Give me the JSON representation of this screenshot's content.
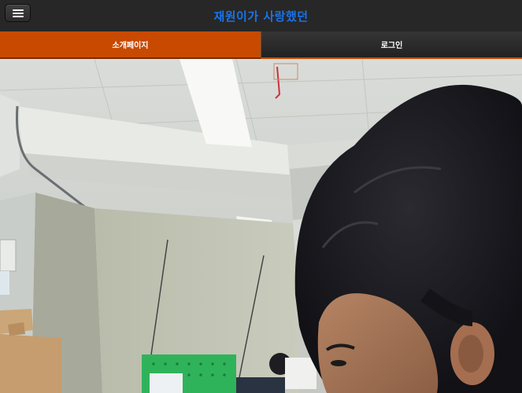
{
  "header": {
    "title": "재원이가 사랑했던",
    "menu_icon": "hamburger-menu-icon"
  },
  "nav": {
    "tabs": [
      {
        "label": "소개페이지",
        "active": true
      },
      {
        "label": "로그인",
        "active": false
      }
    ]
  },
  "colors": {
    "title": "#1a73e8",
    "active_tab": "#c84a00",
    "header_bg": "#272727"
  }
}
